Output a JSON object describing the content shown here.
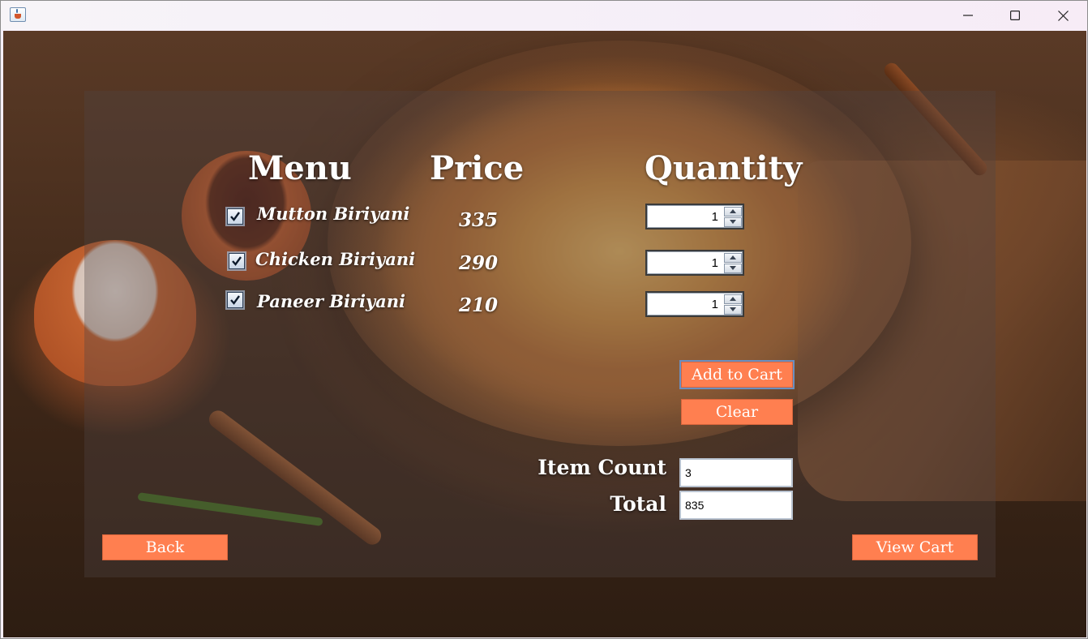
{
  "window": {
    "icon": "java-cup-icon",
    "controls": [
      "minimize-icon",
      "maximize-icon",
      "close-icon"
    ]
  },
  "headings": {
    "menu": "Menu",
    "price": "Price",
    "quantity": "Quantity"
  },
  "items": [
    {
      "name": "Mutton Biriyani",
      "price": "335",
      "checked": true,
      "quantity": "1"
    },
    {
      "name": "Chicken Biriyani",
      "price": "290",
      "checked": true,
      "quantity": "1"
    },
    {
      "name": "Paneer Biriyani",
      "price": "210",
      "checked": true,
      "quantity": "1"
    }
  ],
  "buttons": {
    "add_to_cart": "Add to Cart",
    "clear": "Clear",
    "back": "Back",
    "view_cart": "View Cart"
  },
  "summary": {
    "item_count_label": "Item Count",
    "item_count_value": "3",
    "total_label": "Total",
    "total_value": "835"
  },
  "colors": {
    "button_bg": "#ff7f50",
    "button_text": "#ffffff",
    "heading_text": "#ffffff"
  }
}
